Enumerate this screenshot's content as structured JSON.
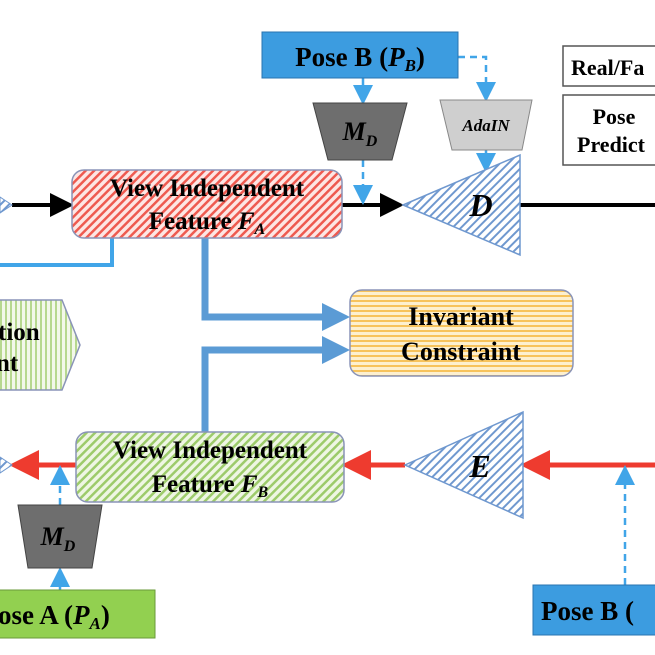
{
  "colors": {
    "pose_b": "#3c9ce0",
    "pose_a": "#92d050",
    "black_arrow": "#000000",
    "red_arrow": "#ee3b2f",
    "blue_arrow": "#5b9bd5",
    "dashed": "#41a5e8",
    "md": "#6e6e6e",
    "adain": "#cfcfcf"
  },
  "pose_b_top": {
    "label": "Pose B (",
    "sym": "P",
    "sub": "B",
    "close": ")"
  },
  "md_top": {
    "sym": "M",
    "sub": "D"
  },
  "adain": {
    "label": "AdaIN"
  },
  "real_fake": {
    "label": "Real/Fa"
  },
  "pose_pred": {
    "line1": "Pose",
    "line2": "Predict"
  },
  "feature_a": {
    "line1": "View Independent",
    "line2": "Feature ",
    "sym": "F",
    "sub": "A"
  },
  "discriminator": {
    "label": "D"
  },
  "left_block": {
    "line1": "tion",
    "line2": "nt"
  },
  "invariant": {
    "line1": "Invariant",
    "line2": "Constraint"
  },
  "feature_b": {
    "line1": "View Independent",
    "line2": "Feature ",
    "sym": "F",
    "sub": "B"
  },
  "encoder": {
    "label": "E"
  },
  "md_bottom": {
    "sym": "M",
    "sub": "D"
  },
  "pose_a": {
    "label": "ose A (",
    "sym": "P",
    "sub": "A",
    "close": ")"
  },
  "pose_b_bottom": {
    "label": "Pose B ("
  }
}
